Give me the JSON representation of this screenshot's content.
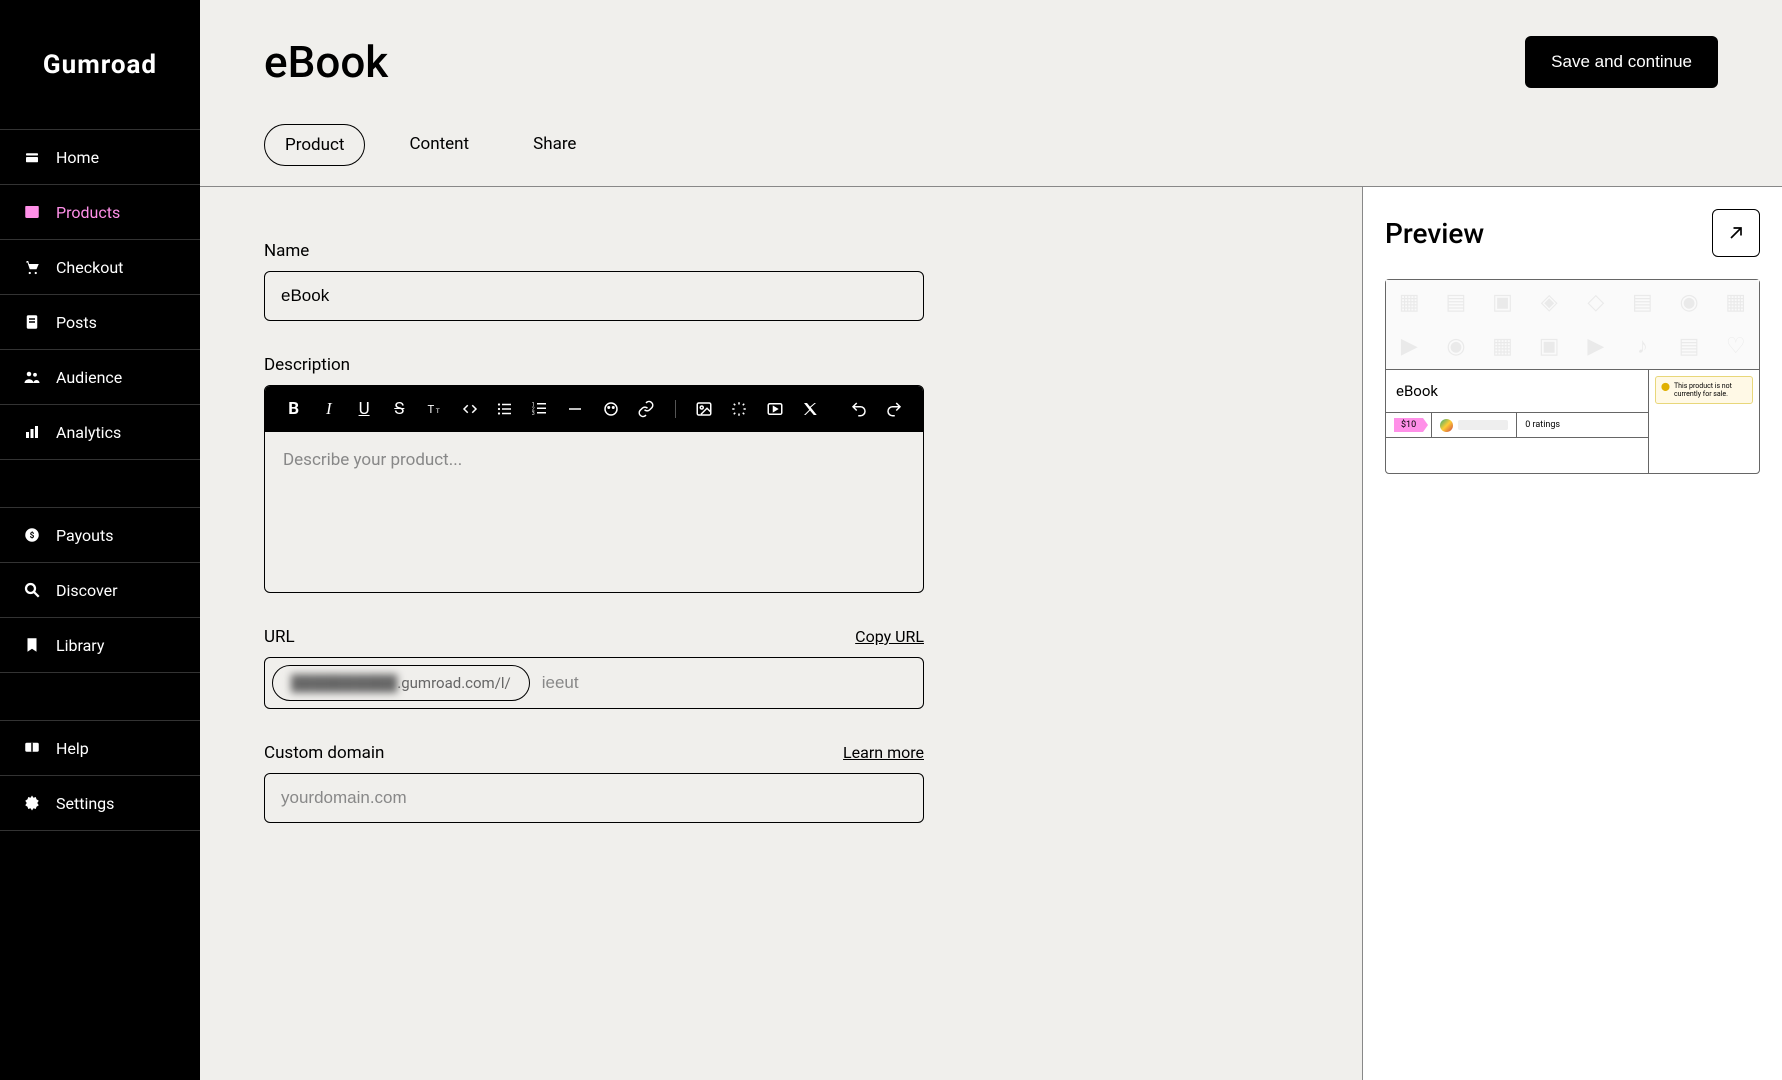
{
  "logo": "Gumroad",
  "sidebar": {
    "items": [
      {
        "label": "Home"
      },
      {
        "label": "Products"
      },
      {
        "label": "Checkout"
      },
      {
        "label": "Posts"
      },
      {
        "label": "Audience"
      },
      {
        "label": "Analytics"
      },
      {
        "label": "Payouts"
      },
      {
        "label": "Discover"
      },
      {
        "label": "Library"
      },
      {
        "label": "Help"
      },
      {
        "label": "Settings"
      }
    ]
  },
  "header": {
    "title": "eBook",
    "save_label": "Save and continue",
    "tabs": [
      {
        "label": "Product"
      },
      {
        "label": "Content"
      },
      {
        "label": "Share"
      }
    ]
  },
  "form": {
    "name": {
      "label": "Name",
      "value": "eBook"
    },
    "description": {
      "label": "Description",
      "placeholder": "Describe your product..."
    },
    "url": {
      "label": "URL",
      "copy_label": "Copy URL",
      "domain_prefix_hidden": "██████████",
      "domain_suffix": ".gumroad.com/l/",
      "slug": "ieeut"
    },
    "custom_domain": {
      "label": "Custom domain",
      "learn_more": "Learn more",
      "placeholder": "yourdomain.com"
    }
  },
  "preview": {
    "title": "Preview",
    "product_name": "eBook",
    "price": "$10",
    "ratings": "0 ratings",
    "warning": "This product is not currently for sale."
  }
}
